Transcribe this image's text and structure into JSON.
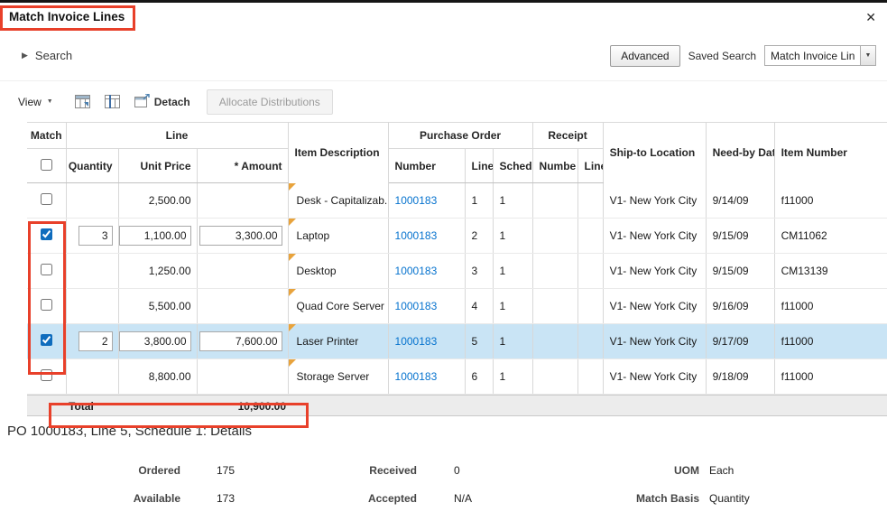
{
  "dialog": {
    "title": "Match Invoice Lines",
    "close_icon": "✕"
  },
  "icons": {
    "disclosure": "▶",
    "view_caret": "▼",
    "dropdown_caret": "▼"
  },
  "colors": {
    "link": "#0572ce",
    "selected_row": "#c9e4f5",
    "annotation": "#e8402a",
    "changed_indicator": "#e8a33c"
  },
  "search": {
    "label": "Search",
    "advanced_button": "Advanced",
    "saved_search_label": "Saved Search",
    "saved_search_value": "Match Invoice Lines"
  },
  "toolbar": {
    "view_label": "View",
    "detach_label": "Detach",
    "allocate_button": "Allocate Distributions"
  },
  "table": {
    "headers": {
      "match": "Match",
      "line_group": "Line",
      "quantity": "Quantity",
      "unit_price": "Unit Price",
      "amount": "* Amount",
      "item_description": "Item Description",
      "po_group": "Purchase Order",
      "po_number": "Number",
      "po_line": "Line",
      "po_schedule": "Schedul",
      "receipt_group": "Receipt",
      "receipt_number": "Numbe",
      "receipt_line": "Line",
      "ship_to": "Ship-to Location",
      "need_by": "Need-by Date",
      "item_number": "Item Number"
    },
    "rows": [
      {
        "checked": false,
        "selected": false,
        "quantity": "",
        "unit_price": "2,500.00",
        "amount": "",
        "item_description": "Desk - Capitalizab...",
        "po_number": "1000183",
        "po_line": "1",
        "po_schedule": "1",
        "ship_to": "V1- New York City",
        "need_by": "9/14/09",
        "item_number": "f11000"
      },
      {
        "checked": true,
        "selected": false,
        "quantity": "3",
        "unit_price": "1,100.00",
        "amount": "3,300.00",
        "item_description": "Laptop",
        "po_number": "1000183",
        "po_line": "2",
        "po_schedule": "1",
        "ship_to": "V1- New York City",
        "need_by": "9/15/09",
        "item_number": "CM11062"
      },
      {
        "checked": false,
        "selected": false,
        "quantity": "",
        "unit_price": "1,250.00",
        "amount": "",
        "item_description": "Desktop",
        "po_number": "1000183",
        "po_line": "3",
        "po_schedule": "1",
        "ship_to": "V1- New York City",
        "need_by": "9/15/09",
        "item_number": "CM13139"
      },
      {
        "checked": false,
        "selected": false,
        "quantity": "",
        "unit_price": "5,500.00",
        "amount": "",
        "item_description": "Quad Core Server",
        "po_number": "1000183",
        "po_line": "4",
        "po_schedule": "1",
        "ship_to": "V1- New York City",
        "need_by": "9/16/09",
        "item_number": "f11000"
      },
      {
        "checked": true,
        "selected": true,
        "quantity": "2",
        "unit_price": "3,800.00",
        "amount": "7,600.00",
        "item_description": "Laser Printer",
        "po_number": "1000183",
        "po_line": "5",
        "po_schedule": "1",
        "ship_to": "V1- New York City",
        "need_by": "9/17/09",
        "item_number": "f11000"
      },
      {
        "checked": false,
        "selected": false,
        "quantity": "",
        "unit_price": "8,800.00",
        "amount": "",
        "item_description": "Storage Server",
        "po_number": "1000183",
        "po_line": "6",
        "po_schedule": "1",
        "ship_to": "V1- New York City",
        "need_by": "9/18/09",
        "item_number": "f11000"
      }
    ],
    "total_label": "Total",
    "total_value": "10,900.00"
  },
  "details": {
    "heading": "PO 1000183, Line 5, Schedule 1: Details",
    "fields": [
      {
        "label": "Ordered",
        "value": "175"
      },
      {
        "label": "Received",
        "value": "0"
      },
      {
        "label": "UOM",
        "value": "Each"
      },
      {
        "label": "Available",
        "value": "173"
      },
      {
        "label": "Accepted",
        "value": "N/A"
      },
      {
        "label": "Match Basis",
        "value": "Quantity"
      }
    ]
  }
}
